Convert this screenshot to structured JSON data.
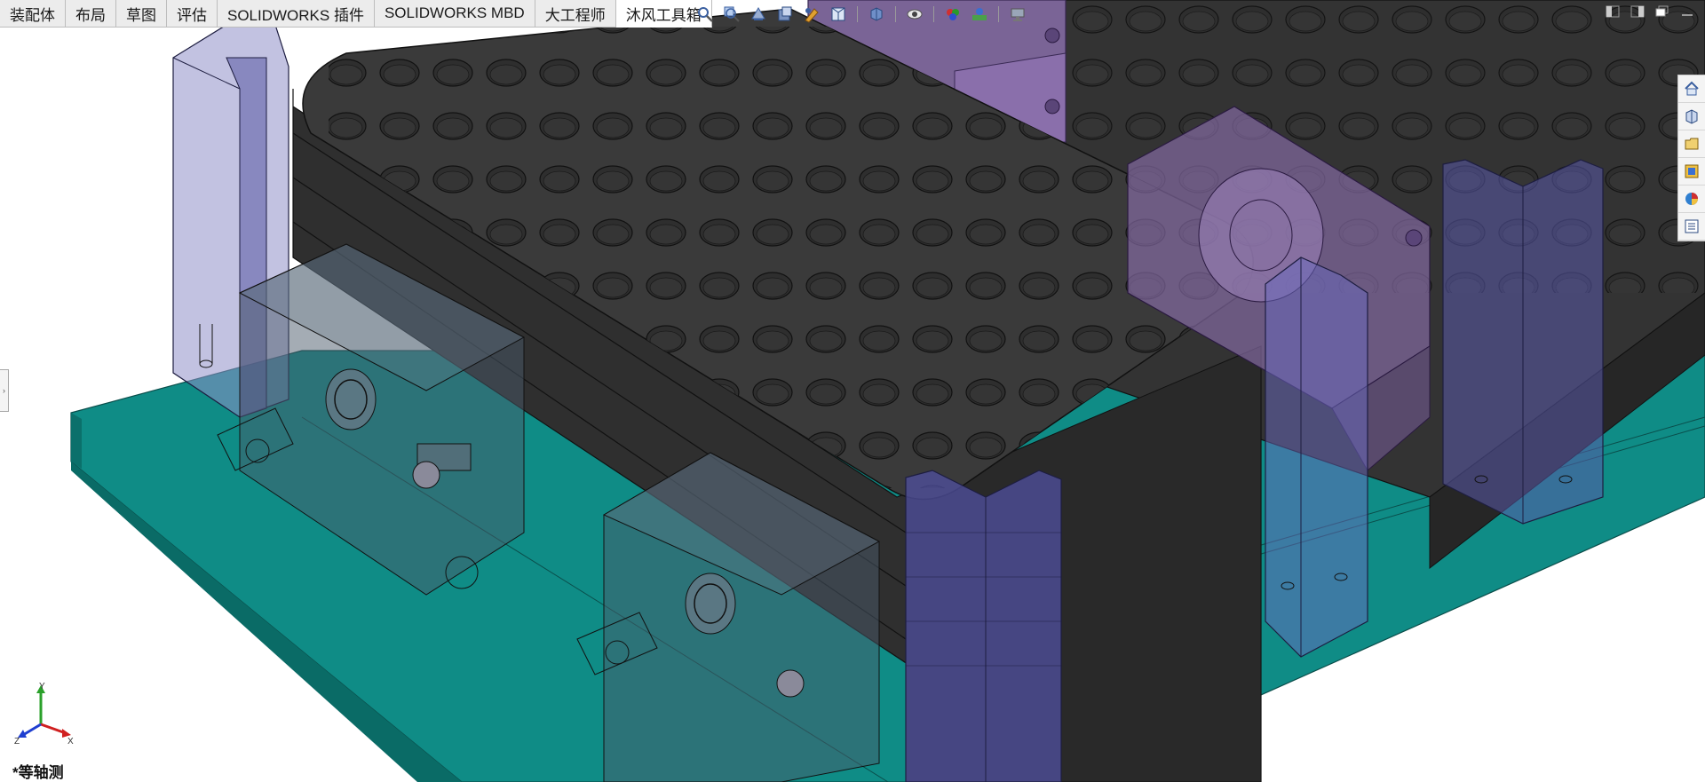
{
  "tabs": [
    {
      "label": "装配体",
      "active": false
    },
    {
      "label": "布局",
      "active": false
    },
    {
      "label": "草图",
      "active": false
    },
    {
      "label": "评估",
      "active": false
    },
    {
      "label": "SOLIDWORKS 插件",
      "active": false
    },
    {
      "label": "SOLIDWORKS MBD",
      "active": false
    },
    {
      "label": "大工程师",
      "active": false
    },
    {
      "label": "沐风工具箱",
      "active": true
    }
  ],
  "heads_up_toolbar": {
    "icons": [
      "zoom-to-fit-icon",
      "zoom-to-area-icon",
      "previous-view-icon",
      "section-view-icon",
      "dynamic-annotation-icon",
      "view-orientation-icon",
      "display-style-icon",
      "hide-show-items-icon",
      "edit-appearance-icon",
      "apply-scene-icon",
      "view-settings-icon"
    ]
  },
  "window_controls": [
    "tile-left-icon",
    "tile-right-icon",
    "restore-icon",
    "minimize-icon"
  ],
  "task_pane": {
    "icons": [
      "home-icon",
      "design-library-icon",
      "file-explorer-icon",
      "view-palette-icon",
      "appearances-icon",
      "custom-properties-icon"
    ]
  },
  "triad": {
    "axes": [
      {
        "label": "Y",
        "color": "#2aa02a"
      },
      {
        "label": "X",
        "color": "#d02020"
      },
      {
        "label": "Z",
        "color": "#1f3fd0"
      }
    ]
  },
  "view_label": "*等轴测",
  "colors": {
    "base_plate": "#0f8c86",
    "tray": "#3a3a3a",
    "transparent_blue": "#5050a0",
    "transparent_purple": "#9a78c0",
    "highlight_tab": "#ffffff"
  }
}
